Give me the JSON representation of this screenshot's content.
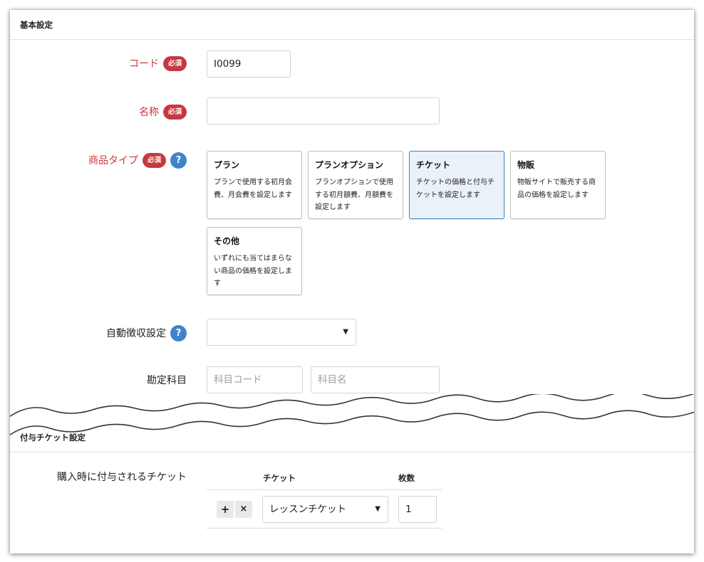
{
  "basic_section": {
    "title": "基本設定"
  },
  "required_badge": "必須",
  "help_glyph": "?",
  "fields": {
    "code": {
      "label": "コード",
      "value": "I0099"
    },
    "name": {
      "label": "名称",
      "value": ""
    },
    "product_type": {
      "label": "商品タイプ",
      "options": [
        {
          "title": "プラン",
          "desc": "プランで使用する初月会費、月会費を設定します",
          "selected": false
        },
        {
          "title": "プランオプション",
          "desc": "プランオプションで使用する初月額費、月額費を設定します",
          "selected": false
        },
        {
          "title": "チケット",
          "desc": "チケットの価格と付与チケットを設定します",
          "selected": true
        },
        {
          "title": "物販",
          "desc": "物販サイトで販売する商品の価格を設定します",
          "selected": false
        },
        {
          "title": "その他",
          "desc": "いずれにも当てはまらない商品の価格を設定します",
          "selected": false
        }
      ]
    },
    "auto_collect": {
      "label": "自動徴収設定",
      "value": ""
    },
    "account": {
      "label": "勘定科目",
      "code_placeholder": "科目コード",
      "name_placeholder": "科目名"
    }
  },
  "ticket_section": {
    "title": "付与チケット設定",
    "row_label": "購入時に付与されるチケット",
    "columns": [
      "チケット",
      "枚数"
    ],
    "rows": [
      {
        "ticket": "レッスンチケット",
        "count": "1"
      }
    ],
    "add_glyph": "+",
    "remove_glyph": "×"
  },
  "colors": {
    "required": "#d0363c",
    "badge": "#c8383f",
    "help": "#3f83cc",
    "selected_bg": "#eaf1f9",
    "selected_border": "#3f83cc"
  }
}
